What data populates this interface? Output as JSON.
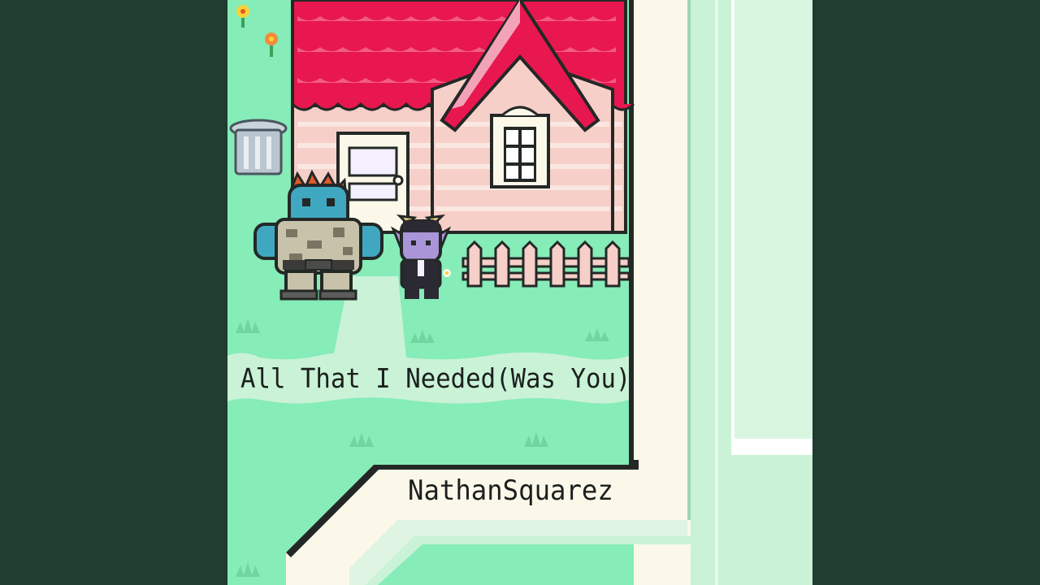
{
  "song": {
    "title": "All That I Needed(Was You)",
    "artist": "NathanSquarez"
  },
  "colors": {
    "background": "#213c31",
    "grass": "#86ecb8",
    "grass_pale": "#c9f2d6",
    "sidewalk": "#fbf8ea",
    "roof": "#e8174f",
    "house_wall": "#f6cfc8",
    "fence": "#f6cfc8"
  },
  "scene": {
    "characters": [
      "blue-reptile-character",
      "purple-horned-character"
    ],
    "objects": [
      "house",
      "door",
      "window",
      "picket-fence",
      "trash-can",
      "flowers",
      "grass-tufts",
      "sidewalk"
    ]
  }
}
